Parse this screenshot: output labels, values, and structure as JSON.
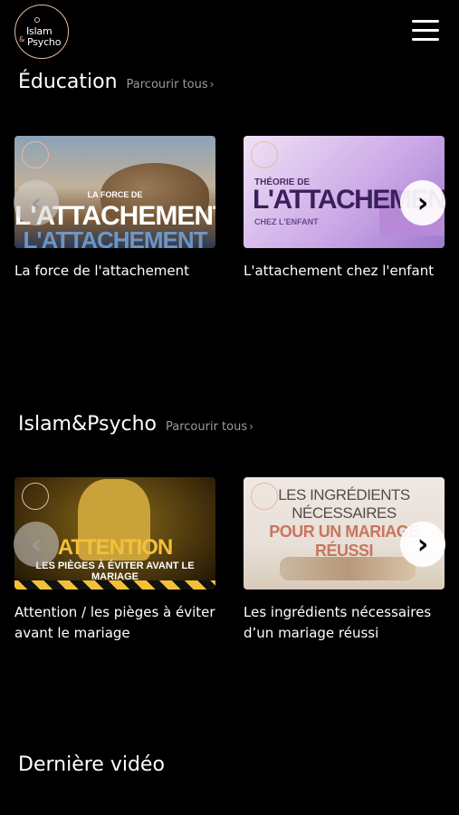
{
  "header": {
    "logo_text_1": "Islam",
    "logo_amp": "&",
    "logo_text_2": "Psycho",
    "menu_icon": "hamburger-menu-icon"
  },
  "sections": [
    {
      "title": "Éducation",
      "browse_label": "Parcourir tous",
      "browse_chevron": "›",
      "cards": [
        {
          "thumb_sub": "LA FORCE DE",
          "thumb_main": "L'ATTACHEMENT",
          "caption": "La force de l'attachement"
        },
        {
          "thumb_sub": "THÉORIE DE",
          "thumb_main": "L'ATTACHEMENT",
          "thumb_sub2": "CHEZ L'ENFANT",
          "caption": "L'attachement chez l'enfant"
        }
      ]
    },
    {
      "title": "Islam&Psycho",
      "browse_label": "Parcourir tous",
      "browse_chevron": "›",
      "cards": [
        {
          "thumb_main": "ATTENTION",
          "thumb_sub": "LES PIÈGES À ÉVITER AVANT LE MARIAGE",
          "caption": "Attention / les pièges à éviter avant le mariage"
        },
        {
          "thumb_l1": "LES INGRÉDIENTS",
          "thumb_l2": "NÉCESSAIRES",
          "thumb_l3": "POUR UN MARIAGE RÉUSSI",
          "caption": "Les ingrédients nécessaires d’un mariage réussi"
        }
      ]
    }
  ],
  "carousel": {
    "prev_glyph": "‹",
    "next_glyph": "›"
  },
  "latest": {
    "title": "Dernière vidéo"
  }
}
